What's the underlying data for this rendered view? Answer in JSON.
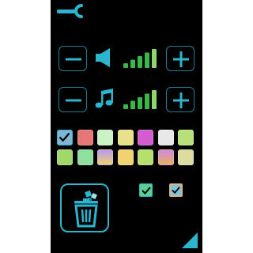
{
  "colors": {
    "accent": "#2bb6cf",
    "accent_dim": "#1a7f93",
    "bars_green": "#38b84a",
    "bars_light": "#8fd66b",
    "check_tile": "#7fb6d3",
    "checkbox_green": "#58d08f",
    "checkbox_orange": "#e0b27a"
  },
  "header": {
    "icon": "wrench-icon"
  },
  "volume_rows": [
    {
      "id": "sound",
      "icon": "speaker-icon",
      "level": 5,
      "max_level": 5
    },
    {
      "id": "music",
      "icon": "music-note-icon",
      "level": 5,
      "max_level": 5
    }
  ],
  "palette": {
    "rows": [
      [
        "#7fb6d3",
        "#e57777",
        "#c9f3c3",
        "#e8e18a",
        "#d45bd0",
        "#e8e8e8",
        "#b8e07a"
      ],
      [
        "#a0d86a",
        "#8fdf9f",
        "#b89af2",
        "#f0d270",
        "#b6df6e",
        "#d08adf",
        "#dcdca0"
      ]
    ],
    "selected_index": 0
  },
  "trash": {
    "icon": "trash-icon"
  },
  "checkboxes": [
    {
      "id": "option-green",
      "checked": true
    },
    {
      "id": "option-orange",
      "checked": true
    }
  ],
  "corner": {
    "icon": "resize-corner-icon"
  }
}
